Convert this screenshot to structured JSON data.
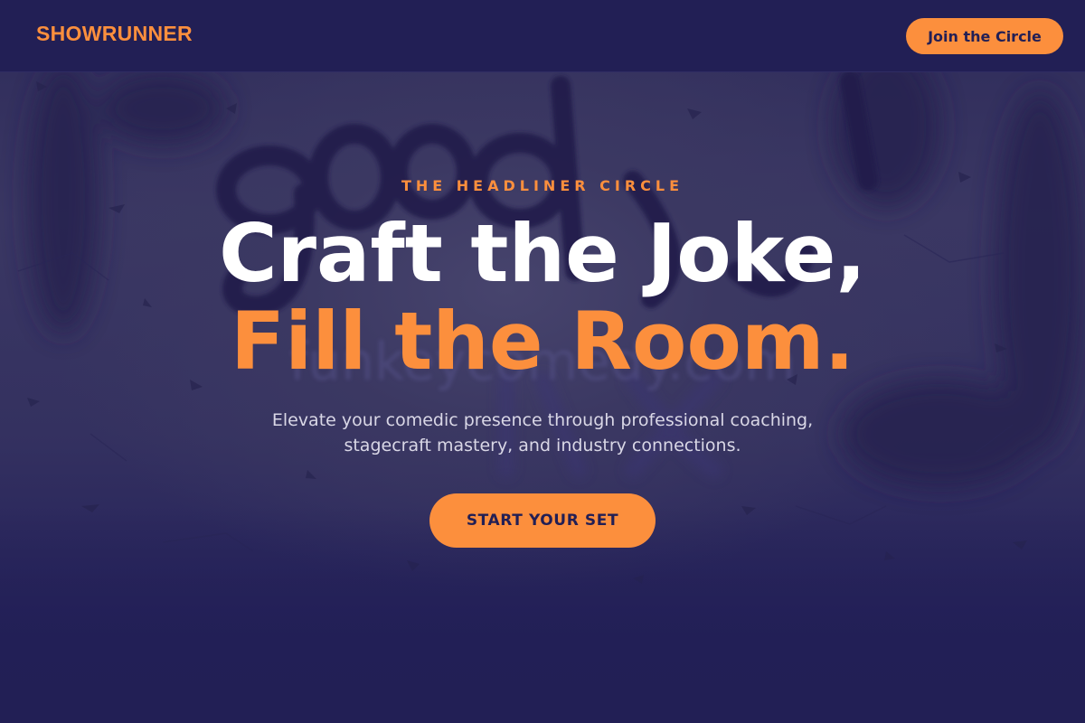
{
  "header": {
    "brand": "SHOWRUNNER",
    "join_button_label": "Join the Circle"
  },
  "hero": {
    "eyebrow": "THE HEADLINER CIRCLE",
    "headline_line1": "Craft the Joke,",
    "headline_line2": "Fill the Room.",
    "subtitle_line1": "Elevate your comedic presence through professional coaching,",
    "subtitle_line2": "stagecraft mastery, and industry connections.",
    "cta_label": "START YOUR SET",
    "background_graffiti": "good",
    "background_watermark": "funkeycomedy.com"
  },
  "colors": {
    "accent": "#fc8f3d",
    "navy": "#221f55",
    "headline": "#ffffff",
    "subtitle": "#d9d7e6"
  }
}
